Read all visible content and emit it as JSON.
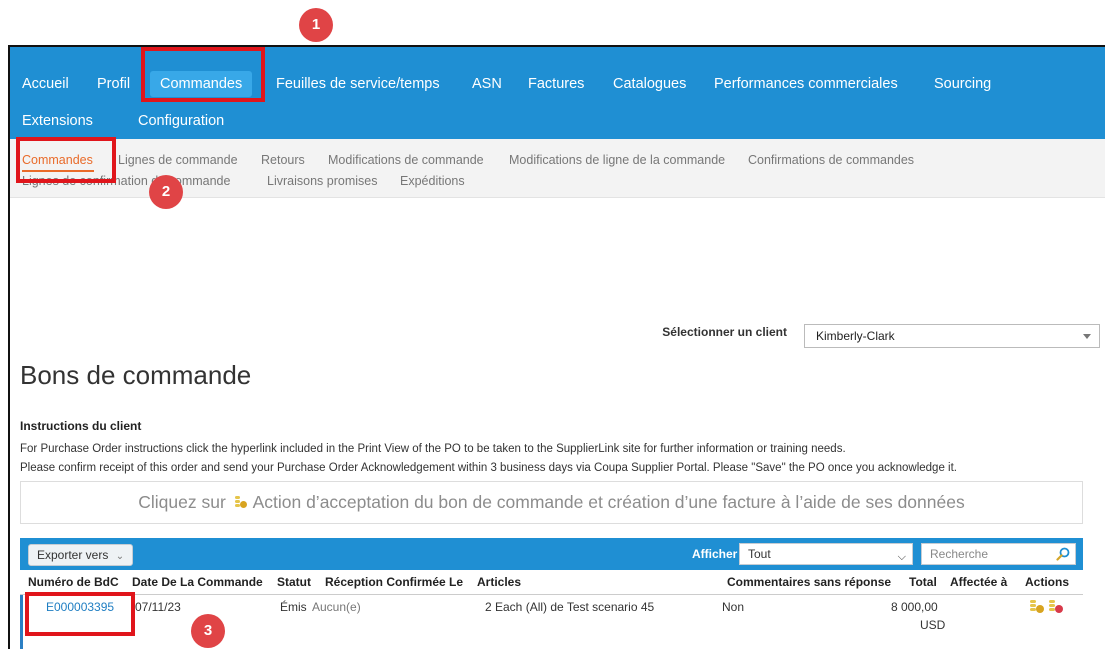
{
  "top_nav": {
    "items": [
      {
        "label": "Accueil"
      },
      {
        "label": "Profil"
      },
      {
        "label": "Commandes",
        "active": true
      },
      {
        "label": "Feuilles de service/temps"
      },
      {
        "label": "ASN"
      },
      {
        "label": "Factures"
      },
      {
        "label": "Catalogues"
      },
      {
        "label": "Performances commerciales"
      },
      {
        "label": "Sourcing"
      },
      {
        "label": "Extensions"
      },
      {
        "label": "Configuration"
      }
    ]
  },
  "sub_nav": {
    "items": [
      {
        "label": "Commandes",
        "active": true
      },
      {
        "label": "Lignes de commande"
      },
      {
        "label": "Retours"
      },
      {
        "label": "Modifications de commande"
      },
      {
        "label": "Modifications de ligne de la commande"
      },
      {
        "label": "Confirmations de commandes"
      },
      {
        "label": "Lignes de confirmation de commande"
      },
      {
        "label": "Livraisons promises"
      },
      {
        "label": "Expéditions"
      }
    ]
  },
  "client": {
    "label": "Sélectionner un client",
    "selected": "Kimberly-Clark"
  },
  "page_title": "Bons de commande",
  "instructions": {
    "heading": "Instructions du client",
    "lines": [
      "For Purchase Order instructions click the hyperlink included in the Print View of the PO to be taken to the SupplierLink site for further information or training needs.",
      "Please confirm receipt of this order and send your Purchase Order Acknowledgement within 3 business days via Coupa Supplier Portal. Please \"Save\" the PO once you acknowledge it."
    ]
  },
  "banner": {
    "prefix": "Cliquez sur",
    "suffix": "Action d’acceptation du bon de commande et création d’une facture à l’aide de ses données",
    "icon": "coin-stack-icon"
  },
  "table": {
    "export_label": "Exporter vers",
    "show_label": "Afficher",
    "filter_value": "Tout",
    "search_placeholder": "Recherche",
    "columns": [
      "Numéro de BdC",
      "Date De La Commande",
      "Statut",
      "Réception Confirmée Le",
      "Articles",
      "Commentaires sans réponse",
      "Total",
      "Affectée à",
      "Actions"
    ],
    "rows": [
      {
        "po_number": "E000003395",
        "date": "07/11/23",
        "status": "Émis",
        "confirmed": "Aucun(e)",
        "items": "2 Each (All) de Test scenario 45",
        "comments": "Non",
        "total_amount": "8 000,00",
        "total_currency": "USD",
        "assigned": ""
      }
    ]
  },
  "annotations": {
    "badge_1": "1",
    "badge_2": "2",
    "badge_3": "3"
  },
  "colors": {
    "nav_bg": "#1f8fd3",
    "active_tab": "#38a8e8",
    "sub_active": "#e96b2a",
    "annotation_red": "#e0151b",
    "link": "#1f7ec2"
  }
}
